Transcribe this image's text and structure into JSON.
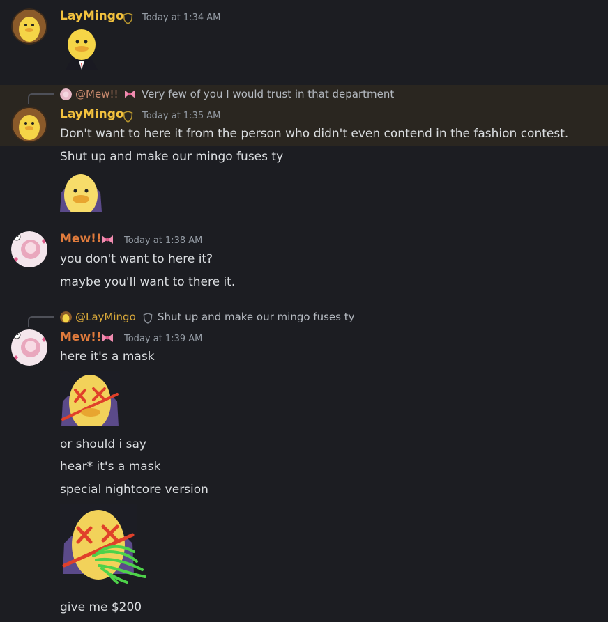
{
  "colors": {
    "background": "#1c1d22",
    "highlight": "#2a2620",
    "laymingo_name": "#f3c23e",
    "mew_name": "#e07b3c",
    "timestamp": "#949ba4",
    "text": "#dbdee1"
  },
  "messages": [
    {
      "author": "LayMingo",
      "badge_icon": "shield-icon",
      "timestamp": "Today at 1:34 AM",
      "sticker": "mingo-suit-sticker"
    },
    {
      "reply": {
        "mention": "@Mew!!",
        "badge_icon": "bow-icon",
        "text": "Very few of you I would trust in that department"
      },
      "author": "LayMingo",
      "badge_icon": "shield-icon",
      "timestamp": "Today at 1:35 AM",
      "lines": [
        "Don't want to here it from the person who didn't even contend in the fashion contest.",
        "Shut up and make our mingo fuses ty"
      ],
      "sticker": "mingo-sticker"
    },
    {
      "author": "Mew!!",
      "badge_icon": "bow-icon",
      "timestamp": "Today at 1:38 AM",
      "lines": [
        "you don't want to here it?",
        "maybe you'll want to there it."
      ]
    },
    {
      "reply": {
        "mention": "@LayMingo",
        "badge_icon": "shield-icon",
        "text": "Shut up and make our mingo fuses ty"
      },
      "author": "Mew!!",
      "badge_icon": "bow-icon",
      "timestamp": "Today at 1:39 AM",
      "lines": [
        "here it's a mask",
        "or should i say",
        "hear* it's a mask",
        "special nightcore version",
        "give me $200"
      ]
    }
  ]
}
